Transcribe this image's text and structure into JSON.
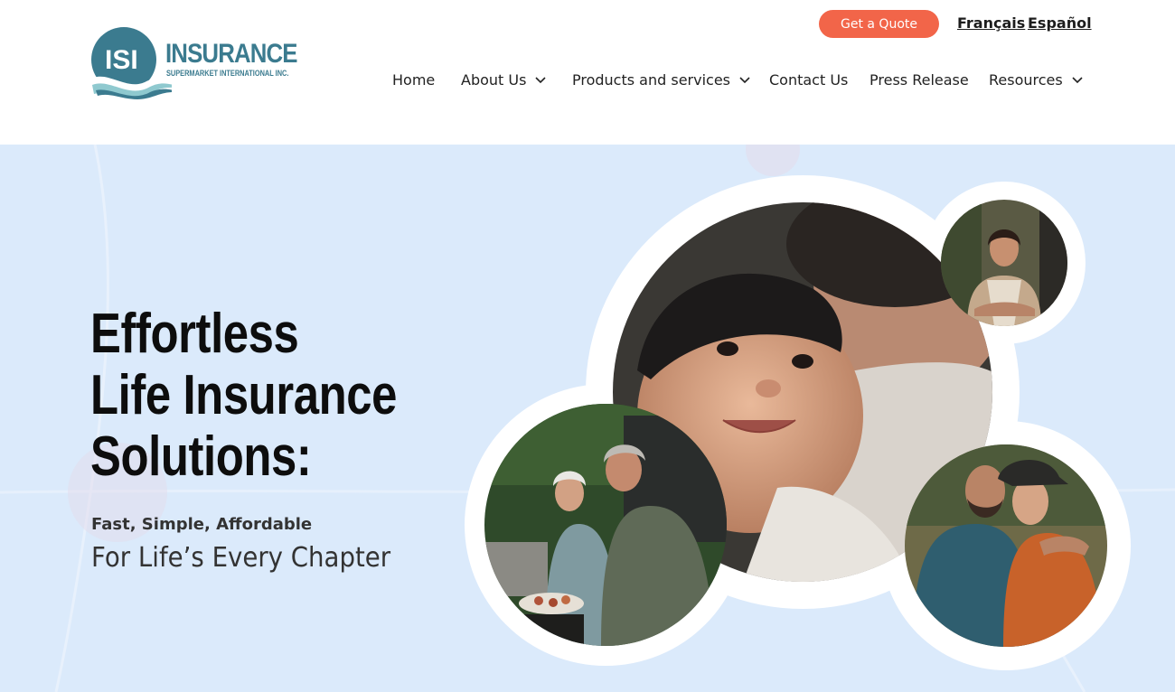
{
  "header": {
    "logo": {
      "mark_text": "ISI",
      "name": "INSURANCE",
      "tagline": "SUPERMARKET INTERNATIONAL INC."
    },
    "quote_button": "Get a Quote",
    "languages": [
      "Français",
      "Español"
    ],
    "nav": [
      {
        "label": "Home",
        "has_dropdown": false
      },
      {
        "label": "About Us",
        "has_dropdown": true
      },
      {
        "label": "Products and services",
        "has_dropdown": true
      },
      {
        "label": "Contact Us",
        "has_dropdown": false
      },
      {
        "label": "Press Release",
        "has_dropdown": false
      },
      {
        "label": "Resources",
        "has_dropdown": true
      }
    ]
  },
  "hero": {
    "headline": [
      "Effortless",
      "Life Insurance",
      "Solutions:"
    ],
    "subheading": "Fast, Simple, Affordable",
    "tagline": "For Life’s Every Chapter",
    "photos": [
      {
        "name": "mother-and-baby-photo"
      },
      {
        "name": "woman-in-apron-photo"
      },
      {
        "name": "senior-couple-barbecue-photo"
      },
      {
        "name": "father-and-son-photo"
      }
    ]
  },
  "colors": {
    "brand_teal": "#3b7b8f",
    "quote_orange": "#f26549",
    "hero_background": "#dbeafb",
    "text_dark": "#0d0d0d"
  }
}
